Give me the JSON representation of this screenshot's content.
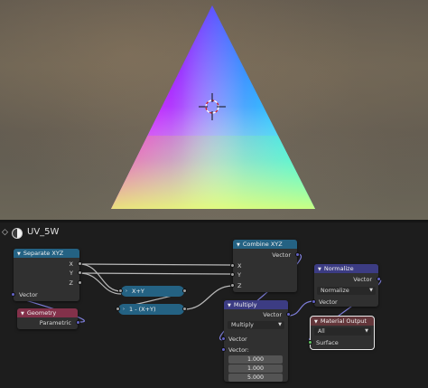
{
  "editor": {
    "material_name": "UV_5W",
    "icons": {
      "collapse": "chevron-down-icon",
      "material": "material-sphere-icon",
      "cursor": "3d-cursor-icon"
    }
  },
  "nodes": {
    "separate_xyz": {
      "title": "Separate XYZ",
      "outputs": [
        "X",
        "Y",
        "Z"
      ],
      "input": "Vector"
    },
    "geometry": {
      "title": "Geometry",
      "output": "Parametric"
    },
    "add": {
      "title": "X+Y"
    },
    "subtract": {
      "title": "1 - (X+Y)"
    },
    "combine_xyz": {
      "title": "Combine XYZ",
      "output": "Vector",
      "inputs": [
        "X",
        "Y",
        "Z"
      ]
    },
    "multiply": {
      "title": "Multiply",
      "output": "Vector",
      "operation": "Multiply",
      "input1": "Vector",
      "input2": "Vector:",
      "values": [
        "1.000",
        "1.000",
        "5.000"
      ]
    },
    "normalize": {
      "title": "Normalize",
      "output": "Vector",
      "operation": "Normalize",
      "input": "Vector"
    },
    "material_output": {
      "title": "Material Output",
      "target": "All",
      "input": "Surface"
    }
  },
  "colors": {
    "converter_header": "#246283",
    "input_header": "#83314a",
    "vector_header": "#3c3c83",
    "output_header": "#63363a",
    "socket_float": "#a1a1a1",
    "socket_vector": "#6363c7",
    "socket_shader": "#63c763"
  }
}
